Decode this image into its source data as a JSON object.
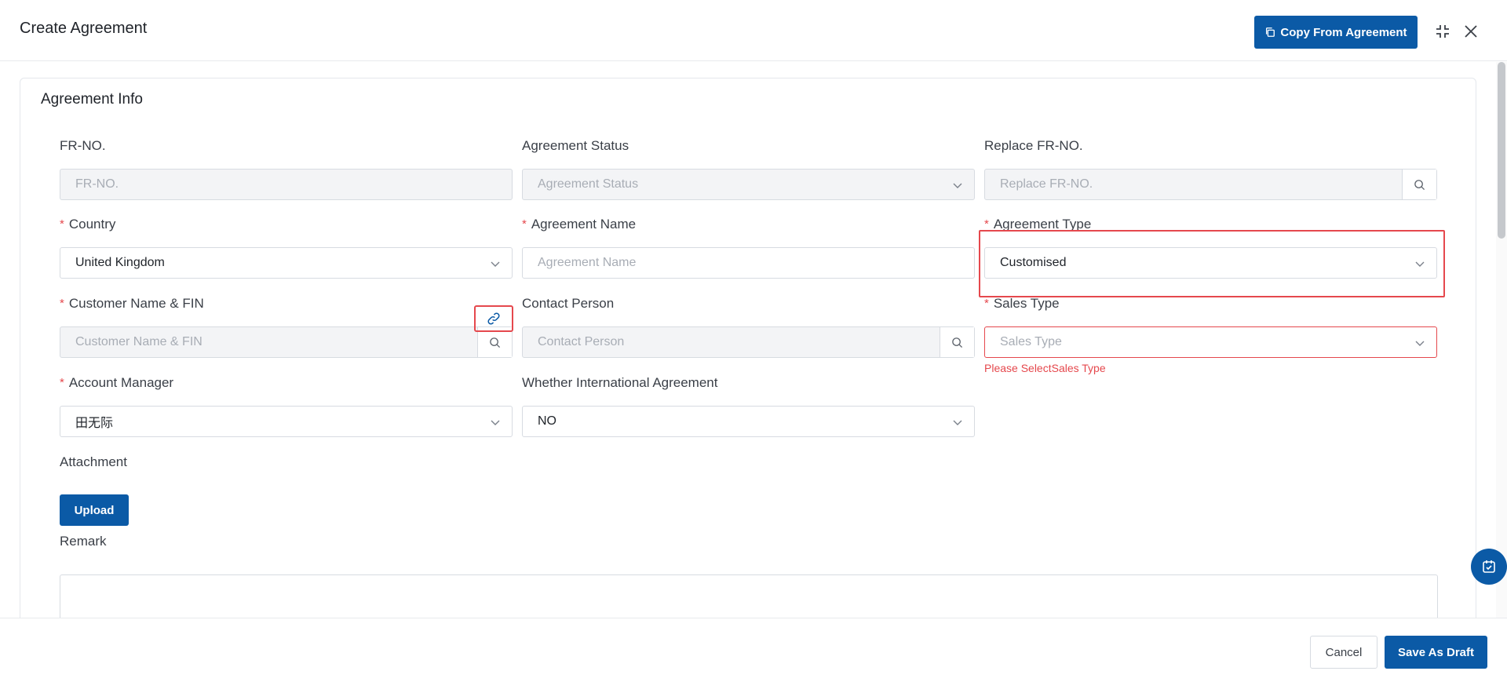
{
  "dialog": {
    "title": "Create Agreement",
    "copy_button": "Copy From Agreement"
  },
  "section": {
    "title": "Agreement Info"
  },
  "fields": {
    "fr_no": {
      "label": "FR-NO.",
      "placeholder": "FR-NO."
    },
    "agreement_status": {
      "label": "Agreement Status",
      "placeholder": "Agreement Status"
    },
    "replace_fr_no": {
      "label": "Replace FR-NO.",
      "placeholder": "Replace FR-NO."
    },
    "country": {
      "label": "Country",
      "value": "United Kingdom",
      "required_mark": "*"
    },
    "agreement_name": {
      "label": "Agreement Name",
      "placeholder": "Agreement Name",
      "required_mark": "*"
    },
    "agreement_type": {
      "label": "Agreement Type",
      "value": "Customised",
      "required_mark": "*"
    },
    "customer_name": {
      "label": "Customer Name & FIN",
      "placeholder": "Customer Name & FIN",
      "required_mark": "*"
    },
    "contact_person": {
      "label": "Contact Person",
      "placeholder": "Contact Person"
    },
    "sales_type": {
      "label": "Sales Type",
      "placeholder": "Sales Type",
      "error": "Please SelectSales Type",
      "required_mark": "*"
    },
    "account_manager": {
      "label": "Account Manager",
      "value": "田无际",
      "required_mark": "*"
    },
    "international": {
      "label": "Whether International Agreement",
      "value": "NO"
    },
    "attachment": {
      "label": "Attachment",
      "upload_button": "Upload"
    },
    "remark": {
      "label": "Remark"
    }
  },
  "footer": {
    "cancel_button": "Cancel",
    "save_button": "Save As Draft"
  },
  "icons": {
    "copy": "copy-icon",
    "collapse": "collapse-icon",
    "close": "close-icon",
    "chevron": "chevron-down-icon",
    "search": "search-icon",
    "link": "link-icon",
    "calendar_check": "calendar-check-icon"
  },
  "colors": {
    "primary": "#0b5aa6",
    "error": "#e5484d"
  }
}
